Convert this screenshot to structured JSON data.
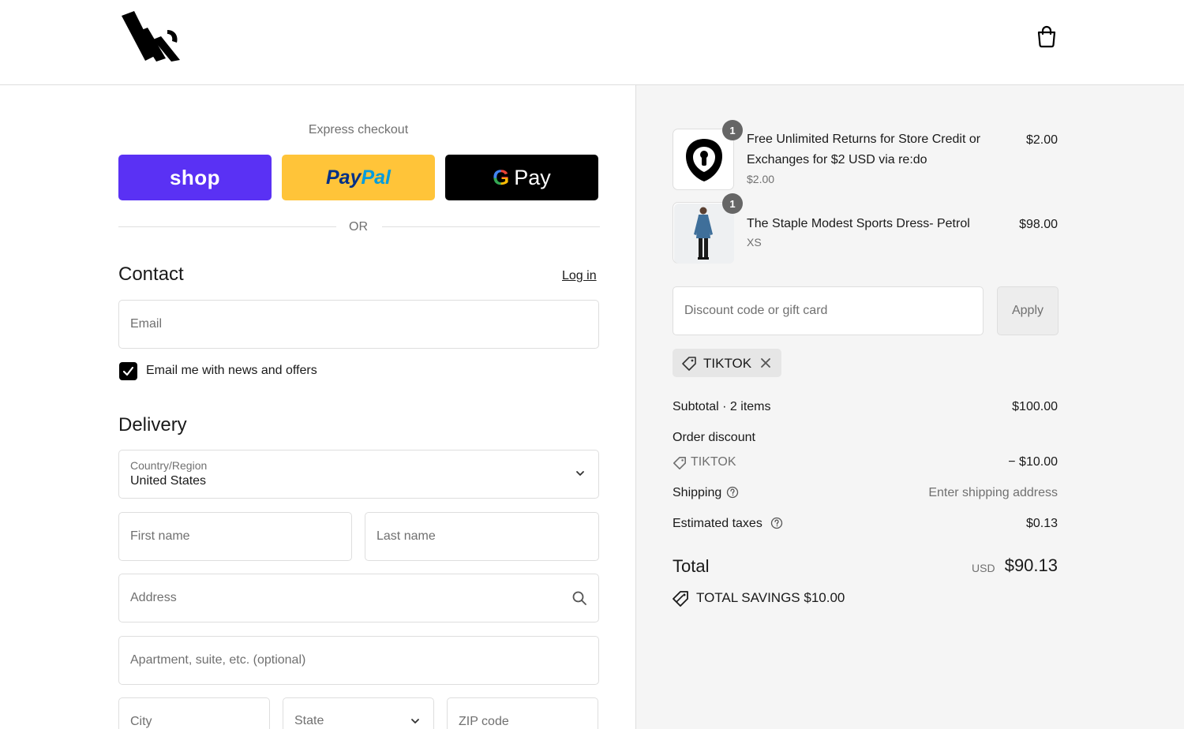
{
  "header": {
    "logo": "store-logo",
    "cart_icon": "shopping-bag-icon"
  },
  "express": {
    "title": "Express checkout",
    "shop_label": "shop",
    "paypal_label_1": "Pay",
    "paypal_label_2": "Pal",
    "gpay_g": "G",
    "gpay_label": "Pay",
    "or_label": "OR"
  },
  "contact": {
    "title": "Contact",
    "login_label": "Log in",
    "email_placeholder": "Email",
    "newsletter_label": "Email me with news and offers",
    "newsletter_checked": true
  },
  "delivery": {
    "title": "Delivery",
    "country_label": "Country/Region",
    "country_value": "United States",
    "first_name_placeholder": "First name",
    "last_name_placeholder": "Last name",
    "address_placeholder": "Address",
    "apartment_placeholder": "Apartment, suite, etc. (optional)",
    "city_placeholder": "City",
    "state_placeholder": "State",
    "zip_placeholder": "ZIP code"
  },
  "summary": {
    "items": [
      {
        "qty": "1",
        "name": "Free Unlimited Returns for Store Credit or Exchanges for $2 USD via re:do",
        "sub": "$2.00",
        "price": "$2.00",
        "thumb": "lock-shield-icon"
      },
      {
        "qty": "1",
        "name": "The Staple Modest Sports Dress- Petrol",
        "sub": "XS",
        "price": "$98.00",
        "thumb": "dress-photo"
      }
    ],
    "discount_placeholder": "Discount code or gift card",
    "apply_label": "Apply",
    "applied_code": "TIKTOK",
    "subtotal_label": "Subtotal · 2 items",
    "subtotal_value": "$100.00",
    "order_discount_label": "Order discount",
    "discount_code": "TIKTOK",
    "discount_value": "− $10.00",
    "shipping_label": "Shipping",
    "shipping_value": "Enter shipping address",
    "taxes_label": "Estimated taxes",
    "taxes_value": "$0.13",
    "total_label": "Total",
    "total_currency": "USD",
    "total_value": "$90.13",
    "savings_label": "TOTAL SAVINGS",
    "savings_value": "$10.00"
  },
  "colors": {
    "shop": "#5a31f4",
    "paypal": "#ffc439",
    "gpay": "#000000",
    "panel": "#f5f5f5"
  }
}
